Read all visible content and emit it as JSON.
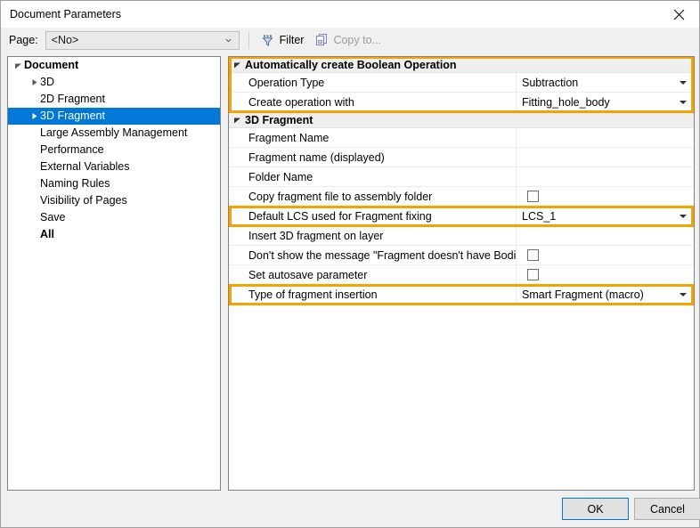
{
  "window": {
    "title": "Document Parameters",
    "close_icon": "close-icon"
  },
  "toolbar": {
    "page_label": "Page:",
    "page_value": "<No>",
    "page_placeholder": "<No>",
    "filter_label": "Filter",
    "filter_icon": "filter-funnel-icon",
    "copy_to_label": "Copy to...",
    "copy_to_icon": "copy-pages-icon"
  },
  "tree": {
    "items": [
      {
        "label": "Document",
        "depth": 0,
        "expander": "expanded",
        "bold": true,
        "selected": false
      },
      {
        "label": "3D",
        "depth": 1,
        "expander": "collapsed",
        "bold": false,
        "selected": false
      },
      {
        "label": "2D Fragment",
        "depth": 1,
        "expander": "none",
        "bold": false,
        "selected": false
      },
      {
        "label": "3D Fragment",
        "depth": 1,
        "expander": "collapsed",
        "bold": false,
        "selected": true
      },
      {
        "label": "Large Assembly Management",
        "depth": 1,
        "expander": "none",
        "bold": false,
        "selected": false
      },
      {
        "label": "Performance",
        "depth": 1,
        "expander": "none",
        "bold": false,
        "selected": false
      },
      {
        "label": "External Variables",
        "depth": 1,
        "expander": "none",
        "bold": false,
        "selected": false
      },
      {
        "label": "Naming Rules",
        "depth": 1,
        "expander": "none",
        "bold": false,
        "selected": false
      },
      {
        "label": "Visibility of Pages",
        "depth": 1,
        "expander": "none",
        "bold": false,
        "selected": false
      },
      {
        "label": "Save",
        "depth": 1,
        "expander": "none",
        "bold": false,
        "selected": false
      },
      {
        "label": "All",
        "depth": 1,
        "expander": "none",
        "bold": true,
        "selected": false
      }
    ]
  },
  "grid": {
    "rows": [
      {
        "kind": "category",
        "label": "Automatically create Boolean Operation",
        "expander": "expanded"
      },
      {
        "kind": "prop",
        "label": "Operation Type",
        "value": "Subtraction",
        "control": "dropdown"
      },
      {
        "kind": "prop",
        "label": "Create operation with",
        "value": "Fitting_hole_body",
        "control": "dropdown"
      },
      {
        "kind": "category",
        "label": "3D Fragment",
        "expander": "expanded"
      },
      {
        "kind": "prop",
        "label": "Fragment Name",
        "value": "",
        "control": "text"
      },
      {
        "kind": "prop",
        "label": "Fragment name (displayed)",
        "value": "",
        "control": "text"
      },
      {
        "kind": "prop",
        "label": "Folder Name",
        "value": "",
        "control": "text"
      },
      {
        "kind": "prop",
        "label": "Copy fragment file to assembly folder",
        "value": "",
        "control": "checkbox",
        "checked": false
      },
      {
        "kind": "prop",
        "label": "Default LCS used for Fragment fixing",
        "value": "LCS_1",
        "control": "dropdown"
      },
      {
        "kind": "prop",
        "label": "Insert 3D fragment on layer",
        "value": "",
        "control": "text"
      },
      {
        "kind": "prop",
        "label": "Don't show the message \"Fragment doesn't have Bodi...",
        "value": "",
        "control": "checkbox",
        "checked": false
      },
      {
        "kind": "prop",
        "label": "Set autosave parameter",
        "value": "",
        "control": "checkbox",
        "checked": false
      },
      {
        "kind": "prop",
        "label": "Type of fragment insertion",
        "value": "Smart Fragment (macro)",
        "control": "dropdown"
      }
    ],
    "highlights": [
      {
        "name": "highlight-boolean-operation-group",
        "from": 0,
        "to": 2
      },
      {
        "name": "highlight-default-lcs-row",
        "from": 8,
        "to": 8
      },
      {
        "name": "highlight-type-of-insertion-row",
        "from": 12,
        "to": 12
      }
    ]
  },
  "footer": {
    "ok_label": "OK",
    "cancel_label": "Cancel"
  },
  "colors": {
    "highlight": "#f5a300",
    "selection": "#0078d7",
    "category_bg": "#efefef"
  }
}
